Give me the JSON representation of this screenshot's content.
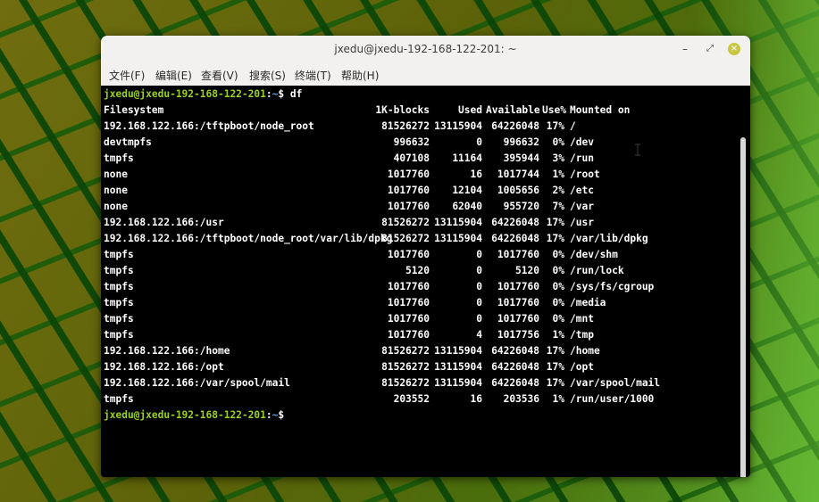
{
  "window": {
    "title": "jxedu@jxedu-192-168-122-201: ~",
    "close_glyph": "×",
    "minimize_glyph": "–",
    "maximize_glyph": "⤢"
  },
  "menu": {
    "file": "文件(F)",
    "edit": "编辑(E)",
    "view": "查看(V)",
    "search": "搜索(S)",
    "terminal": "终端(T)",
    "help": "帮助(H)"
  },
  "terminal": {
    "prompt_user": "jxedu@jxedu-192-168-122-201",
    "prompt_sep": ":",
    "prompt_path": "~",
    "prompt_dollar": "$",
    "command": " df",
    "header": {
      "filesystem": "Filesystem",
      "blocks": "1K-blocks",
      "used": "Used",
      "available": "Available",
      "use_pct": "Use%",
      "mounted_on": "Mounted on"
    },
    "rows": [
      {
        "fs": "192.168.122.166:/tftpboot/node_root",
        "blocks": "81526272",
        "used": "13115904",
        "avail": "64226048",
        "pct": "17%",
        "mnt": "/"
      },
      {
        "fs": "devtmpfs",
        "blocks": "996632",
        "used": "0",
        "avail": "996632",
        "pct": "0%",
        "mnt": "/dev"
      },
      {
        "fs": "tmpfs",
        "blocks": "407108",
        "used": "11164",
        "avail": "395944",
        "pct": "3%",
        "mnt": "/run"
      },
      {
        "fs": "none",
        "blocks": "1017760",
        "used": "16",
        "avail": "1017744",
        "pct": "1%",
        "mnt": "/root"
      },
      {
        "fs": "none",
        "blocks": "1017760",
        "used": "12104",
        "avail": "1005656",
        "pct": "2%",
        "mnt": "/etc"
      },
      {
        "fs": "none",
        "blocks": "1017760",
        "used": "62040",
        "avail": "955720",
        "pct": "7%",
        "mnt": "/var"
      },
      {
        "fs": "192.168.122.166:/usr",
        "blocks": "81526272",
        "used": "13115904",
        "avail": "64226048",
        "pct": "17%",
        "mnt": "/usr"
      },
      {
        "fs": "192.168.122.166:/tftpboot/node_root/var/lib/dpkg",
        "blocks": "81526272",
        "used": "13115904",
        "avail": "64226048",
        "pct": "17%",
        "mnt": "/var/lib/dpkg"
      },
      {
        "fs": "tmpfs",
        "blocks": "1017760",
        "used": "0",
        "avail": "1017760",
        "pct": "0%",
        "mnt": "/dev/shm"
      },
      {
        "fs": "tmpfs",
        "blocks": "5120",
        "used": "0",
        "avail": "5120",
        "pct": "0%",
        "mnt": "/run/lock"
      },
      {
        "fs": "tmpfs",
        "blocks": "1017760",
        "used": "0",
        "avail": "1017760",
        "pct": "0%",
        "mnt": "/sys/fs/cgroup"
      },
      {
        "fs": "tmpfs",
        "blocks": "1017760",
        "used": "0",
        "avail": "1017760",
        "pct": "0%",
        "mnt": "/media"
      },
      {
        "fs": "tmpfs",
        "blocks": "1017760",
        "used": "0",
        "avail": "1017760",
        "pct": "0%",
        "mnt": "/mnt"
      },
      {
        "fs": "tmpfs",
        "blocks": "1017760",
        "used": "4",
        "avail": "1017756",
        "pct": "1%",
        "mnt": "/tmp"
      },
      {
        "fs": "192.168.122.166:/home",
        "blocks": "81526272",
        "used": "13115904",
        "avail": "64226048",
        "pct": "17%",
        "mnt": "/home"
      },
      {
        "fs": "192.168.122.166:/opt",
        "blocks": "81526272",
        "used": "13115904",
        "avail": "64226048",
        "pct": "17%",
        "mnt": "/opt"
      },
      {
        "fs": "192.168.122.166:/var/spool/mail",
        "blocks": "81526272",
        "used": "13115904",
        "avail": "64226048",
        "pct": "17%",
        "mnt": "/var/spool/mail"
      },
      {
        "fs": "tmpfs",
        "blocks": "203552",
        "used": "16",
        "avail": "203536",
        "pct": "1%",
        "mnt": "/run/user/1000"
      }
    ]
  },
  "colors": {
    "prompt_user": "#9ad21e",
    "prompt_path": "#5aa0ff",
    "terminal_bg": "#000000",
    "titlebar_bg": "#f2f1f0"
  },
  "icons": {
    "text_cursor": "i-beam-cursor-icon"
  }
}
